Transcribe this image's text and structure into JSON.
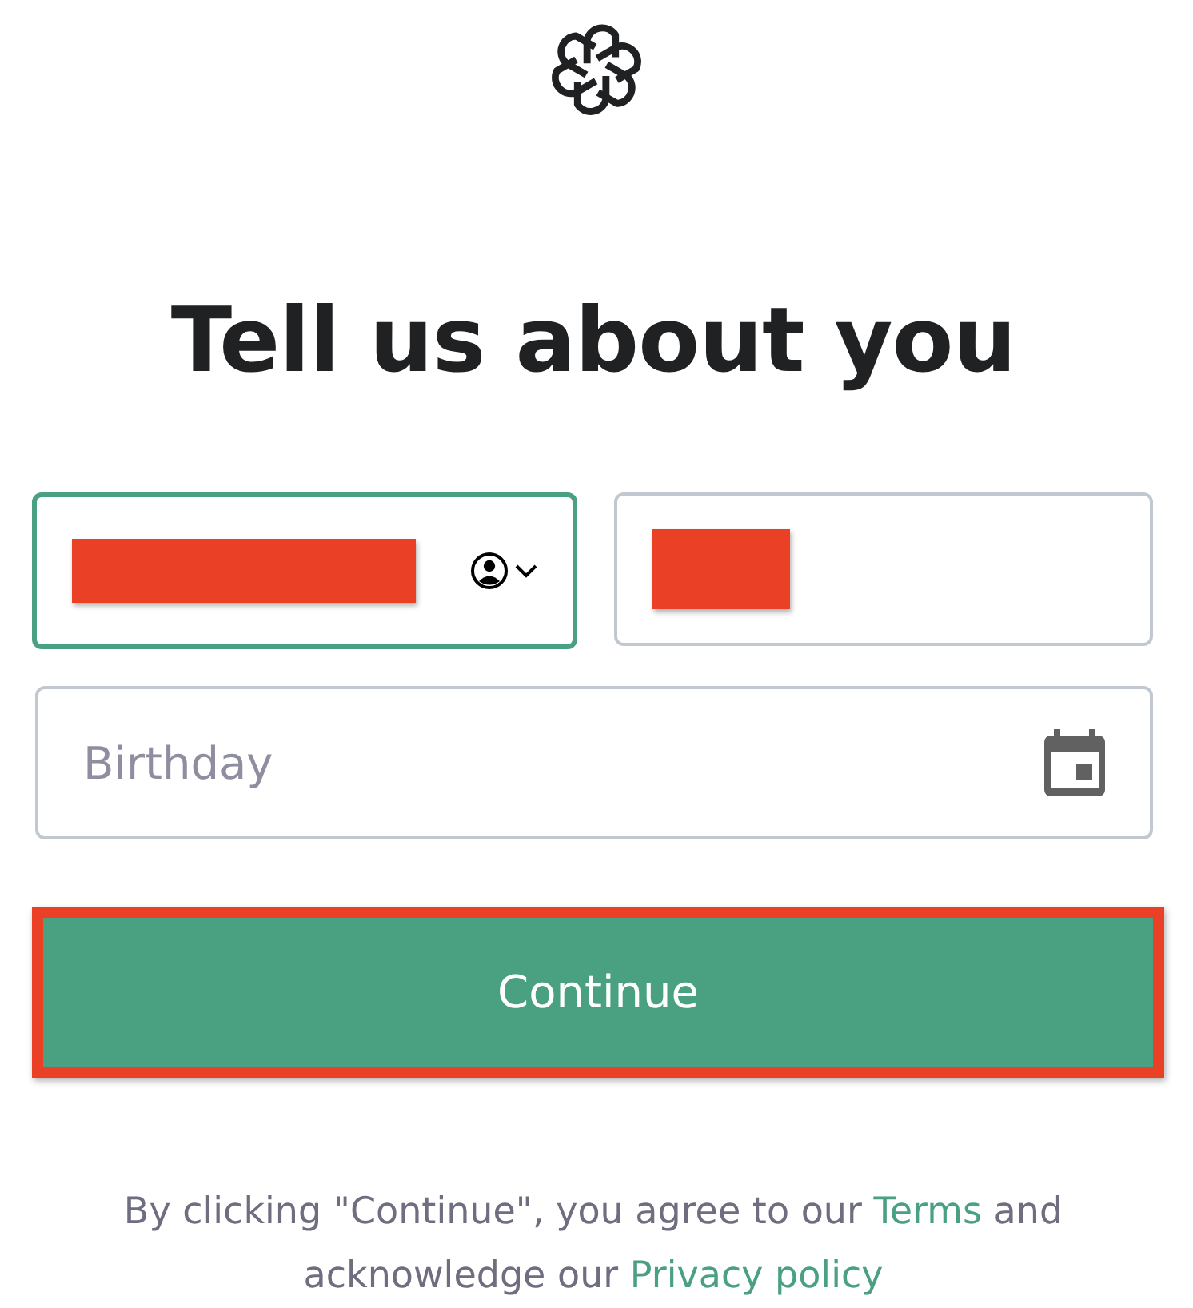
{
  "heading": "Tell us about you",
  "fields": [
    {
      "kind": "name",
      "focused": true,
      "redacted": true
    },
    {
      "kind": "text",
      "focused": false,
      "redacted": true
    },
    {
      "kind": "date",
      "focused": false,
      "redacted": false,
      "placeholder": "Birthday"
    }
  ],
  "continue_button": {
    "label": "Continue",
    "highlighted": true
  },
  "legal": [
    {
      "kind": "plain",
      "text": "By clicking \"Continue\", you agree to our"
    },
    {
      "kind": "link",
      "text": "Terms"
    },
    {
      "kind": "plain",
      "text": "and acknowledge our"
    },
    {
      "kind": "link",
      "text": "Privacy policy"
    }
  ]
}
